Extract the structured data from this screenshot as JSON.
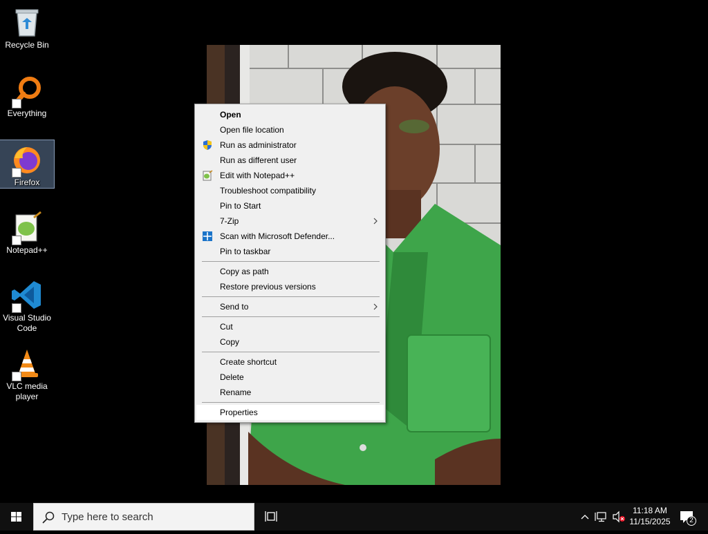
{
  "desktop": {
    "icons": [
      {
        "label": "Recycle Bin",
        "icon": "recycle-bin-icon"
      },
      {
        "label": "Everything",
        "icon": "everything-icon"
      },
      {
        "label": "Firefox",
        "icon": "firefox-icon"
      },
      {
        "label": "Notepad++",
        "icon": "notepad-plus-plus-icon"
      },
      {
        "label": "Visual Studio Code",
        "icon": "vscode-icon"
      },
      {
        "label": "VLC media player",
        "icon": "vlc-icon"
      }
    ],
    "selected_icon": "Firefox"
  },
  "context_menu": {
    "groups": [
      [
        {
          "label": "Open",
          "bold": true
        },
        {
          "label": "Open file location"
        },
        {
          "label": "Run as administrator",
          "icon": "uac-shield-icon"
        },
        {
          "label": "Run as different user"
        },
        {
          "label": "Edit with Notepad++",
          "icon": "notepad-plus-plus-icon"
        },
        {
          "label": "Troubleshoot compatibility"
        },
        {
          "label": "Pin to Start"
        },
        {
          "label": "7-Zip",
          "submenu": true
        },
        {
          "label": "Scan with Microsoft Defender...",
          "icon": "defender-icon"
        },
        {
          "label": "Pin to taskbar"
        }
      ],
      [
        {
          "label": "Copy as path"
        },
        {
          "label": "Restore previous versions"
        }
      ],
      [
        {
          "label": "Send to",
          "submenu": true
        }
      ],
      [
        {
          "label": "Cut"
        },
        {
          "label": "Copy"
        }
      ],
      [
        {
          "label": "Create shortcut"
        },
        {
          "label": "Delete"
        },
        {
          "label": "Rename"
        }
      ],
      [
        {
          "label": "Properties",
          "hovered": true
        }
      ]
    ]
  },
  "taskbar": {
    "search_placeholder": "Type here to search",
    "clock": {
      "time": "11:18 AM",
      "date": "11/15/2025"
    },
    "notification_count": "2"
  },
  "colors": {
    "taskbar_bg": "#101010",
    "menu_bg": "#f0f0f0",
    "menu_hover": "#ffffff",
    "selection": "#7896be",
    "windows_blue": "#0078d7"
  }
}
